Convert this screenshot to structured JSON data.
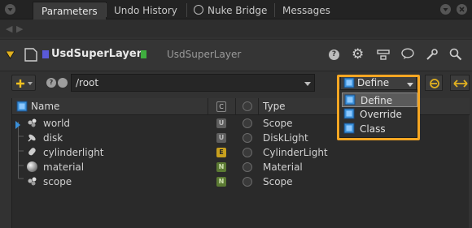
{
  "tabs": [
    {
      "label": "Parameters"
    },
    {
      "label": "Undo History"
    },
    {
      "label": "Nuke Bridge"
    },
    {
      "label": "Messages"
    }
  ],
  "header": {
    "node_name": "UsdSuperLayer",
    "node_class": "UsdSuperLayer"
  },
  "controls": {
    "path_value": "/root",
    "specifier_selected": "Define"
  },
  "tree": {
    "columns": {
      "name": "Name",
      "c": "C",
      "type": "Type"
    },
    "rows": [
      {
        "name": "world",
        "badge": "U",
        "type": "Scope",
        "badge_color": "#5e5e5e"
      },
      {
        "name": "disk",
        "badge": "U",
        "type": "DiskLight",
        "badge_color": "#5e5e5e"
      },
      {
        "name": "cylinderlight",
        "badge": "E",
        "type": "CylinderLight",
        "badge_color": "#c8a01e"
      },
      {
        "name": "material",
        "badge": "N",
        "type": "Material",
        "badge_color": "#5b7a33"
      },
      {
        "name": "scope",
        "badge": "N",
        "type": "Scope",
        "badge_color": "#5b7a33"
      }
    ]
  },
  "dropdown": {
    "options": [
      "Define",
      "Override",
      "Class"
    ],
    "highlighted": "Define"
  },
  "colors": {
    "highlight_border": "#f5a623",
    "accent_yellow": "#e0b020",
    "usd_blue": "#3a8fd8"
  }
}
